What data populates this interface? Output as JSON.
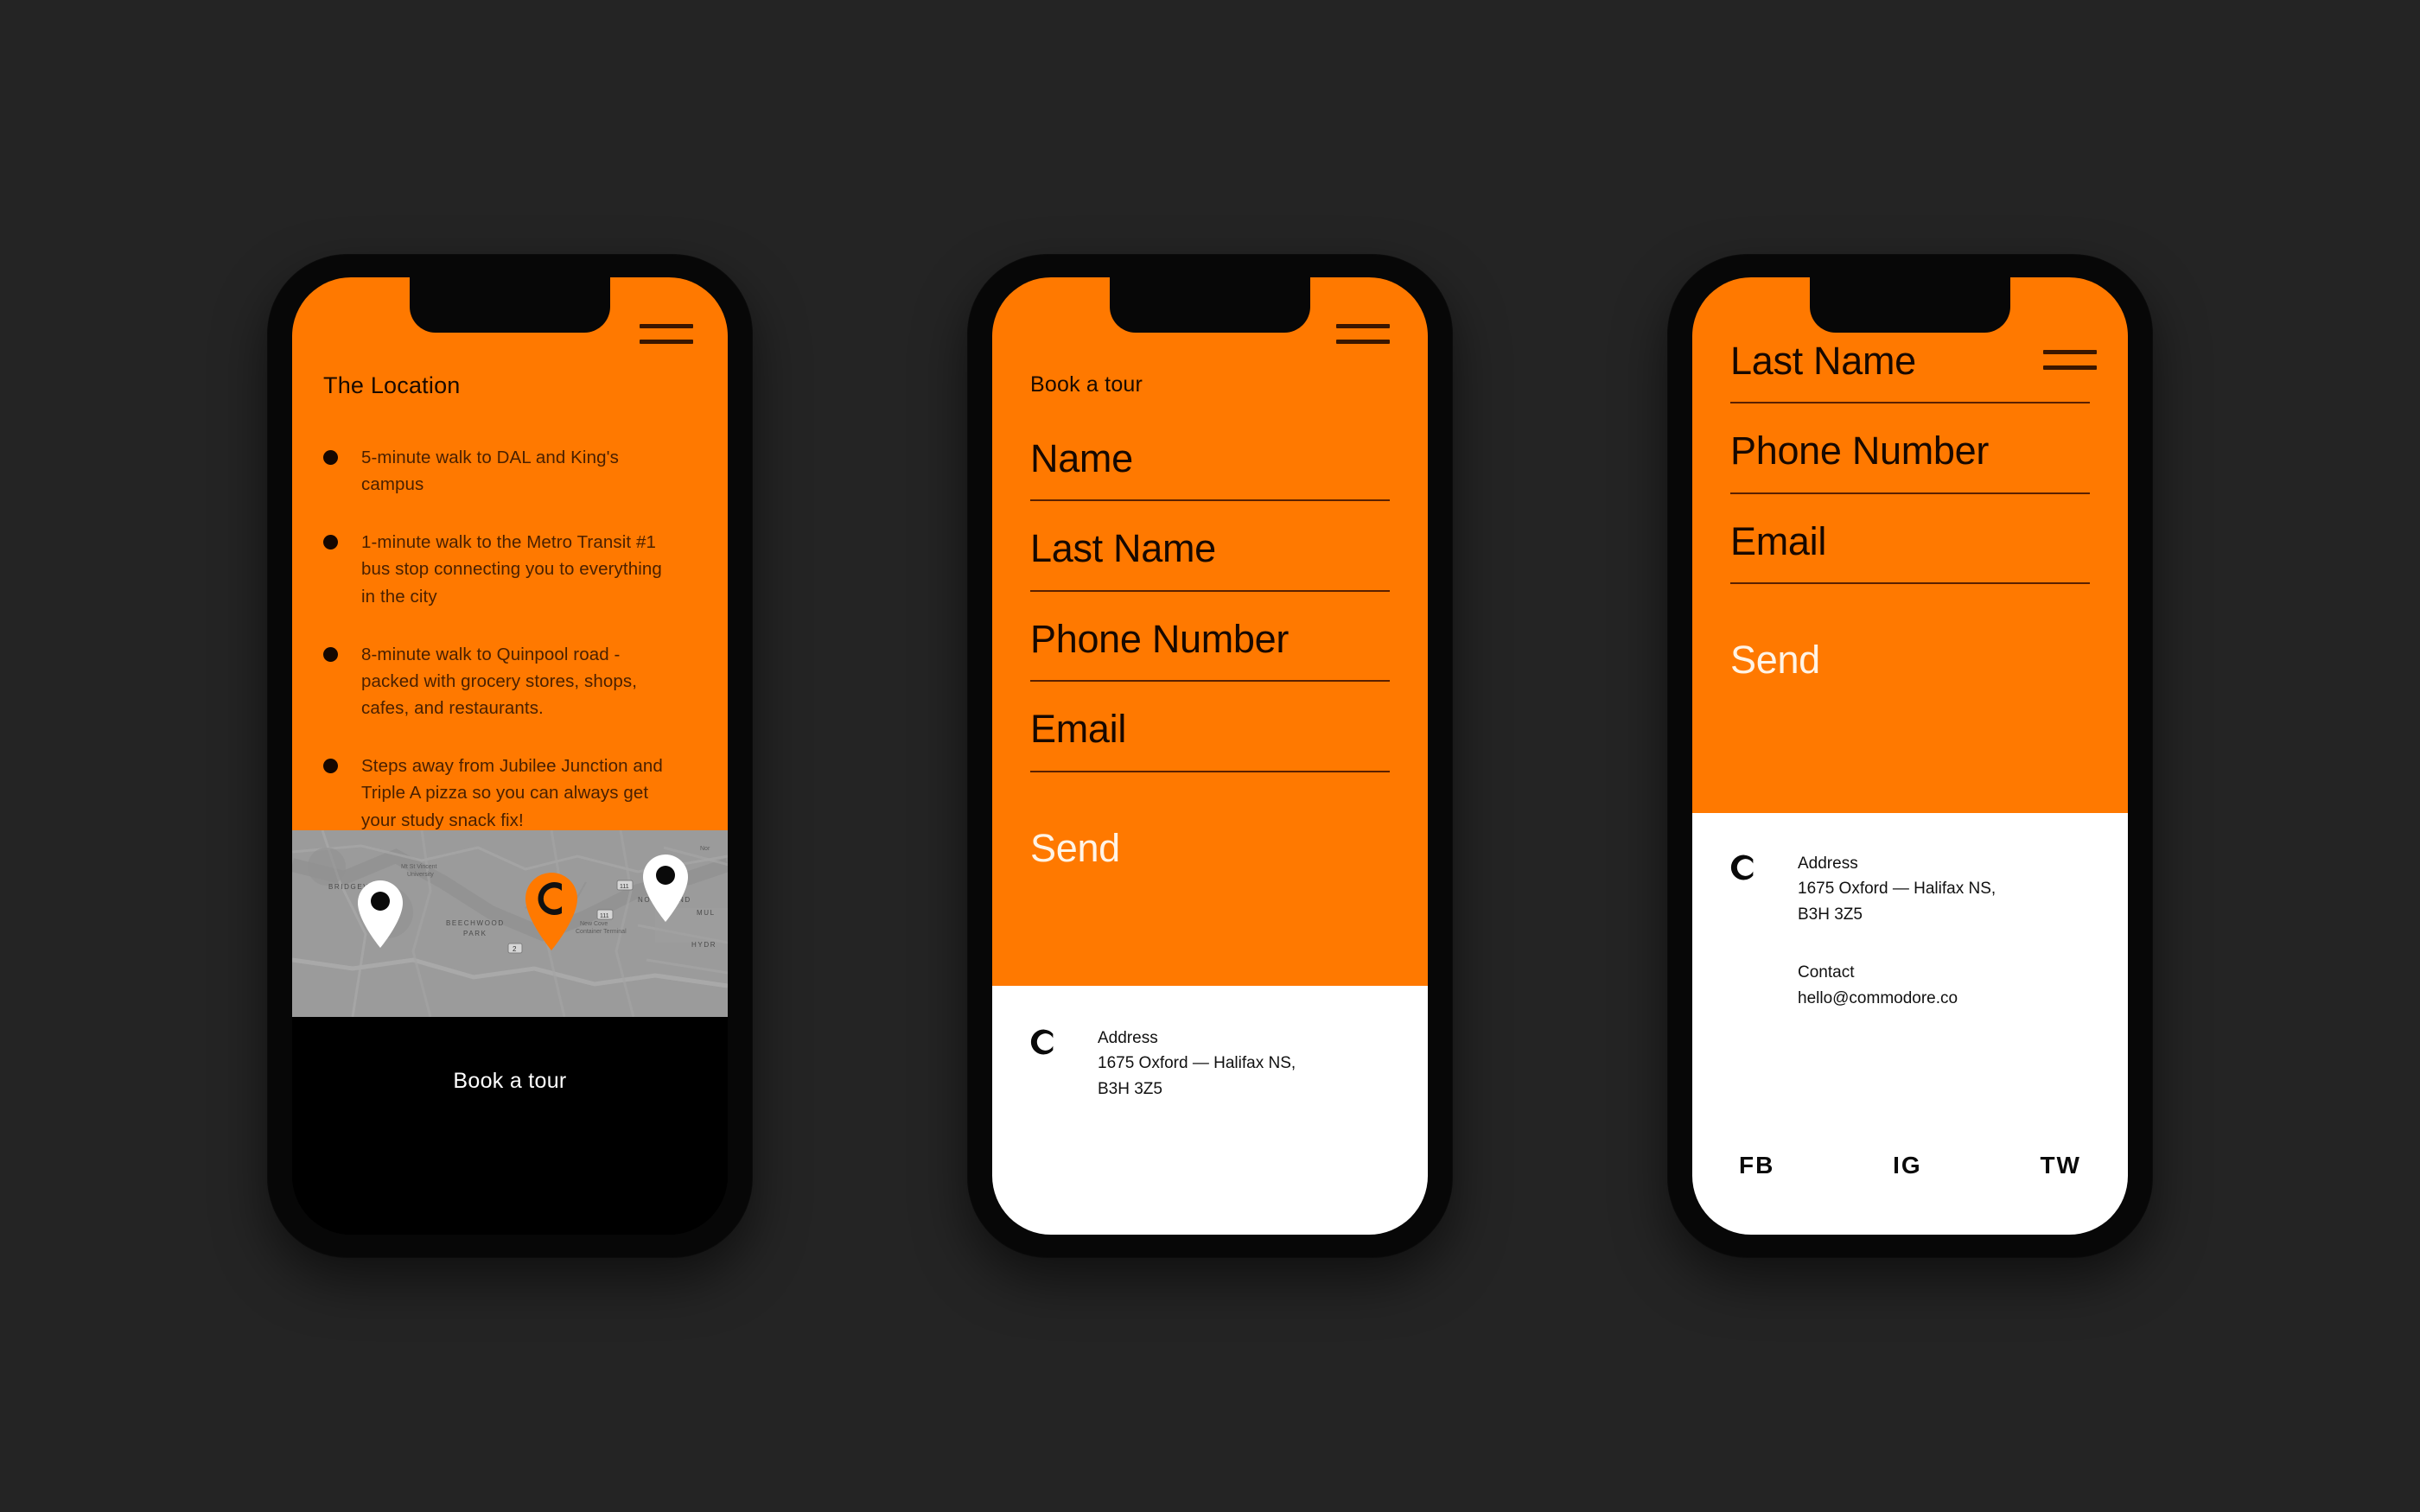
{
  "theme": {
    "background": "#242424",
    "orange": "#FF7900",
    "dark_text": "#1a0a00",
    "muted_text": "#4a2000",
    "cream": "#FFF4E6",
    "white": "#FFFFFF",
    "black": "#000000",
    "map_gray": "#9B9B9B"
  },
  "screens": [
    {
      "id": "location-screen",
      "menu_icon": "hamburger-icon",
      "title": "The Location",
      "features": [
        "5-minute walk to DAL and King's campus",
        "1-minute walk to the Metro Transit #1 bus stop connecting you to everything in the city",
        "8-minute walk to Quinpool road - packed with grocery stores, shops, cafes, and restaurants.",
        "Steps away from Jubilee Junction and Triple A pizza so you can always get your study snack fix!"
      ],
      "map": {
        "pins": [
          {
            "kind": "white-pin",
            "label": ""
          },
          {
            "kind": "brand-pin",
            "label": "C"
          },
          {
            "kind": "white-pin",
            "label": ""
          }
        ],
        "labels": [
          "BRIDGEVIEW",
          "BEECHWOOD PARK",
          "Mt St Vincent University",
          "NORTH END",
          "MUL",
          "HYDR",
          "Nor",
          "New Cove Container Terminal",
          "2",
          "111",
          "111"
        ]
      },
      "footer_cta": "Book a tour"
    },
    {
      "id": "book-a-tour-screen",
      "menu_icon": "hamburger-icon",
      "title": "Book a tour",
      "fields": [
        {
          "label": "Name",
          "value": "",
          "placeholder": "Name"
        },
        {
          "label": "Last Name",
          "value": "",
          "placeholder": "Last Name"
        },
        {
          "label": "Phone Number",
          "value": "",
          "placeholder": "Phone Number"
        },
        {
          "label": "Email",
          "value": "",
          "placeholder": "Email"
        }
      ],
      "submit_label": "Send",
      "contact": {
        "logo": "commodore-c-logo",
        "address_heading": "Address",
        "address_line1": "1675 Oxford — Halifax NS,",
        "address_line2": "B3H 3Z5"
      }
    },
    {
      "id": "book-a-tour-scrolled-screen",
      "menu_icon": "hamburger-icon",
      "fields": [
        {
          "label": "Last Name",
          "value": "",
          "placeholder": "Last Name"
        },
        {
          "label": "Phone Number",
          "value": "",
          "placeholder": "Phone Number"
        },
        {
          "label": "Email",
          "value": "",
          "placeholder": "Email"
        }
      ],
      "submit_label": "Send",
      "contact": {
        "logo": "commodore-c-logo",
        "address_heading": "Address",
        "address_line1": "1675 Oxford — Halifax NS,",
        "address_line2": "B3H 3Z5",
        "contact_heading": "Contact",
        "contact_email": "hello@commodore.co"
      },
      "social": [
        {
          "label": "FB",
          "name": "facebook"
        },
        {
          "label": "IG",
          "name": "instagram"
        },
        {
          "label": "TW",
          "name": "twitter"
        }
      ]
    }
  ]
}
